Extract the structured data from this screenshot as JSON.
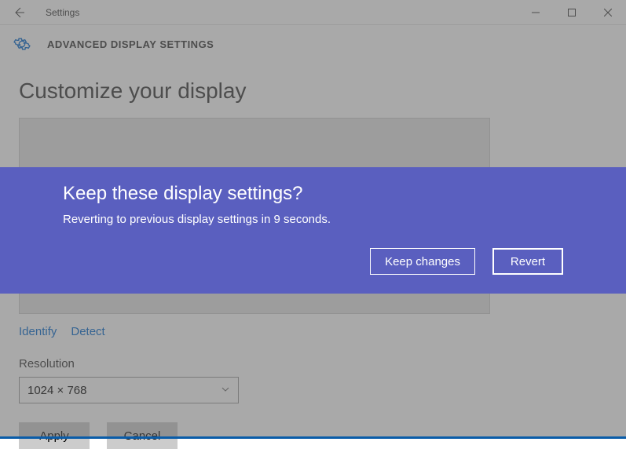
{
  "window": {
    "title": "Settings"
  },
  "header": {
    "title": "ADVANCED DISPLAY SETTINGS"
  },
  "page": {
    "heading": "Customize your display",
    "identify_link": "Identify",
    "detect_link": "Detect",
    "resolution_label": "Resolution",
    "resolution_value": "1024 × 768",
    "apply_label": "Apply",
    "cancel_label": "Cancel"
  },
  "dialog": {
    "title": "Keep these display settings?",
    "body": "Reverting to previous display settings in  9 seconds.",
    "keep_label": "Keep changes",
    "revert_label": "Revert"
  },
  "colors": {
    "dialog_bg": "#5a5fbf"
  }
}
